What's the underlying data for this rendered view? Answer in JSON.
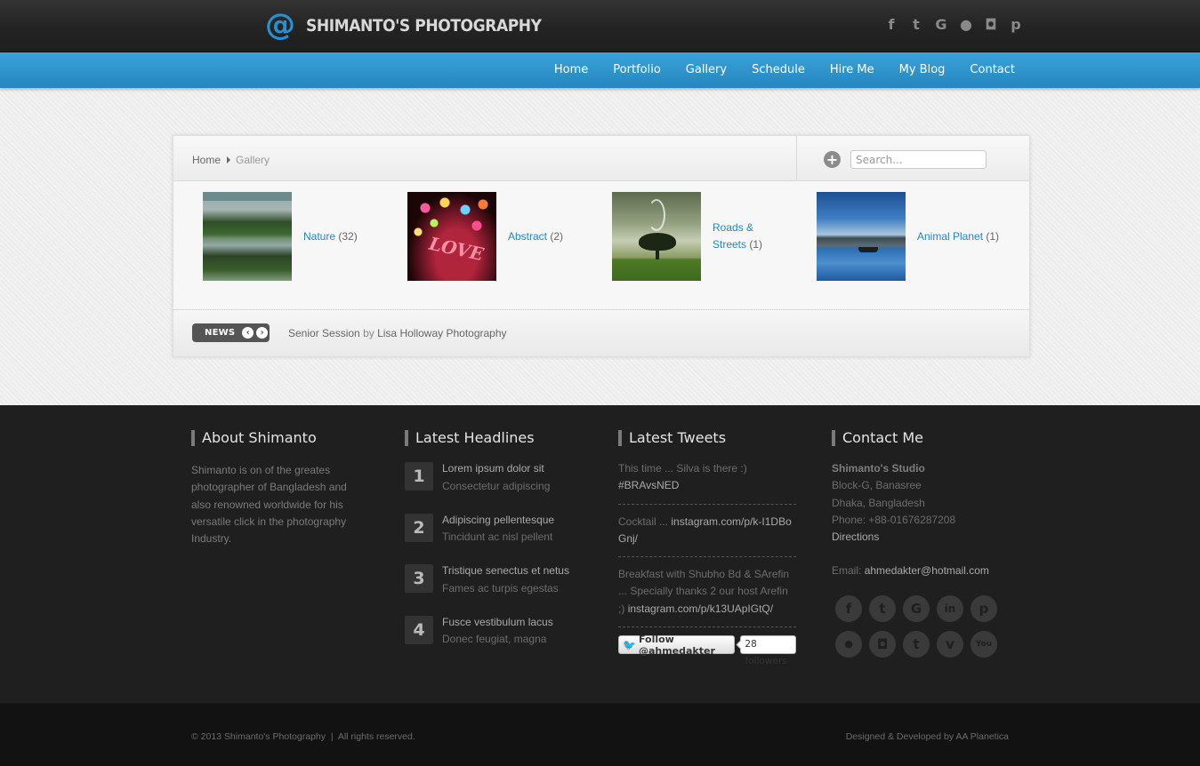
{
  "header": {
    "logo_symbol": "@",
    "logo_text": "SHIMANTO'S PHOTOGRAPHY",
    "accent_color": "#2a8fd0",
    "social_icons": [
      {
        "name": "facebook-icon",
        "glyph": "f"
      },
      {
        "name": "twitter-icon",
        "glyph": "t"
      },
      {
        "name": "google-plus-icon",
        "glyph": "G"
      },
      {
        "name": "flickr-icon",
        "glyph": "●"
      },
      {
        "name": "instagram-icon",
        "glyph": "◘"
      },
      {
        "name": "pinterest-icon",
        "glyph": "p"
      }
    ]
  },
  "nav": {
    "items": [
      "Home",
      "Portfolio",
      "Gallery",
      "Schedule",
      "Hire Me",
      "My Blog",
      "Contact"
    ]
  },
  "breadcrumb": {
    "home": "Home",
    "current": "Gallery"
  },
  "search": {
    "placeholder": "Search..."
  },
  "gallery": [
    {
      "label": "Nature",
      "count": "(32)"
    },
    {
      "label": "Abstract",
      "count": "(2)"
    },
    {
      "label": "Roads & Streets",
      "count": "(1)"
    },
    {
      "label": "Animal Planet",
      "count": "(1)"
    }
  ],
  "gallery_thumb_text": {
    "abstract": "LOVE"
  },
  "news": {
    "badge": "NEWS",
    "title": "Senior Session",
    "by": "by",
    "author": "Lisa Holloway Photography"
  },
  "footer": {
    "about": {
      "title": "About Shimanto",
      "text": "Shimanto is on of the greates photographer of Bangladesh and also renowned worldwide for his versatile click in the photography Industry."
    },
    "headlines": {
      "title": "Latest Headlines",
      "items": [
        {
          "num": "1",
          "title": "Lorem ipsum dolor sit",
          "sub": "Consectetur adipiscing"
        },
        {
          "num": "2",
          "title": "Adipiscing pellentesque",
          "sub": "Tincidunt ac nisl pellent"
        },
        {
          "num": "3",
          "title": "Tristique senectus et netus",
          "sub": "Fames ac turpis egestas"
        },
        {
          "num": "4",
          "title": "Fusce vestibulum lacus",
          "sub": "Donec feugiat, magna"
        }
      ]
    },
    "tweets": {
      "title": "Latest Tweets",
      "items": [
        {
          "text": "This time ... Silva is there :)",
          "link": "#BRAvsNED"
        },
        {
          "text": "Cocktail ...",
          "link": "instagram.com/p/k-I1DBoGnj/"
        },
        {
          "text": "Breakfast with Shubho Bd & SArefin ... Specially thanks 2 our host Arefin ;)",
          "link": "instagram.com/p/k13UApIGtQ/"
        }
      ],
      "follow_label": "Follow @ahmedakter",
      "followers": "28 followers"
    },
    "contact": {
      "title": "Contact Me",
      "studio": "Shimanto's Studio",
      "address1": "Block-G, Banasree",
      "address2": "Dhaka, Bangladesh",
      "phone": "Phone: +88-01676287208",
      "directions": "Directions",
      "email_label": "Email:",
      "email": "ahmedakter@hotmail.com",
      "social_icons": [
        {
          "name": "facebook-icon",
          "glyph": "f"
        },
        {
          "name": "twitter-icon",
          "glyph": "t"
        },
        {
          "name": "google-plus-icon",
          "glyph": "G"
        },
        {
          "name": "linkedin-icon",
          "glyph": "in"
        },
        {
          "name": "pinterest-icon",
          "glyph": "p"
        },
        {
          "name": "flickr-icon",
          "glyph": "●"
        },
        {
          "name": "instagram-icon",
          "glyph": "◘"
        },
        {
          "name": "tumblr-icon",
          "glyph": "t"
        },
        {
          "name": "vimeo-icon",
          "glyph": "v"
        },
        {
          "name": "youtube-icon",
          "glyph": "You"
        }
      ]
    }
  },
  "bottom": {
    "copyright": "© 2013 Shimanto's Photography  |  All rights reserved.",
    "credit": "Designed & Developed by AA Planetica"
  }
}
